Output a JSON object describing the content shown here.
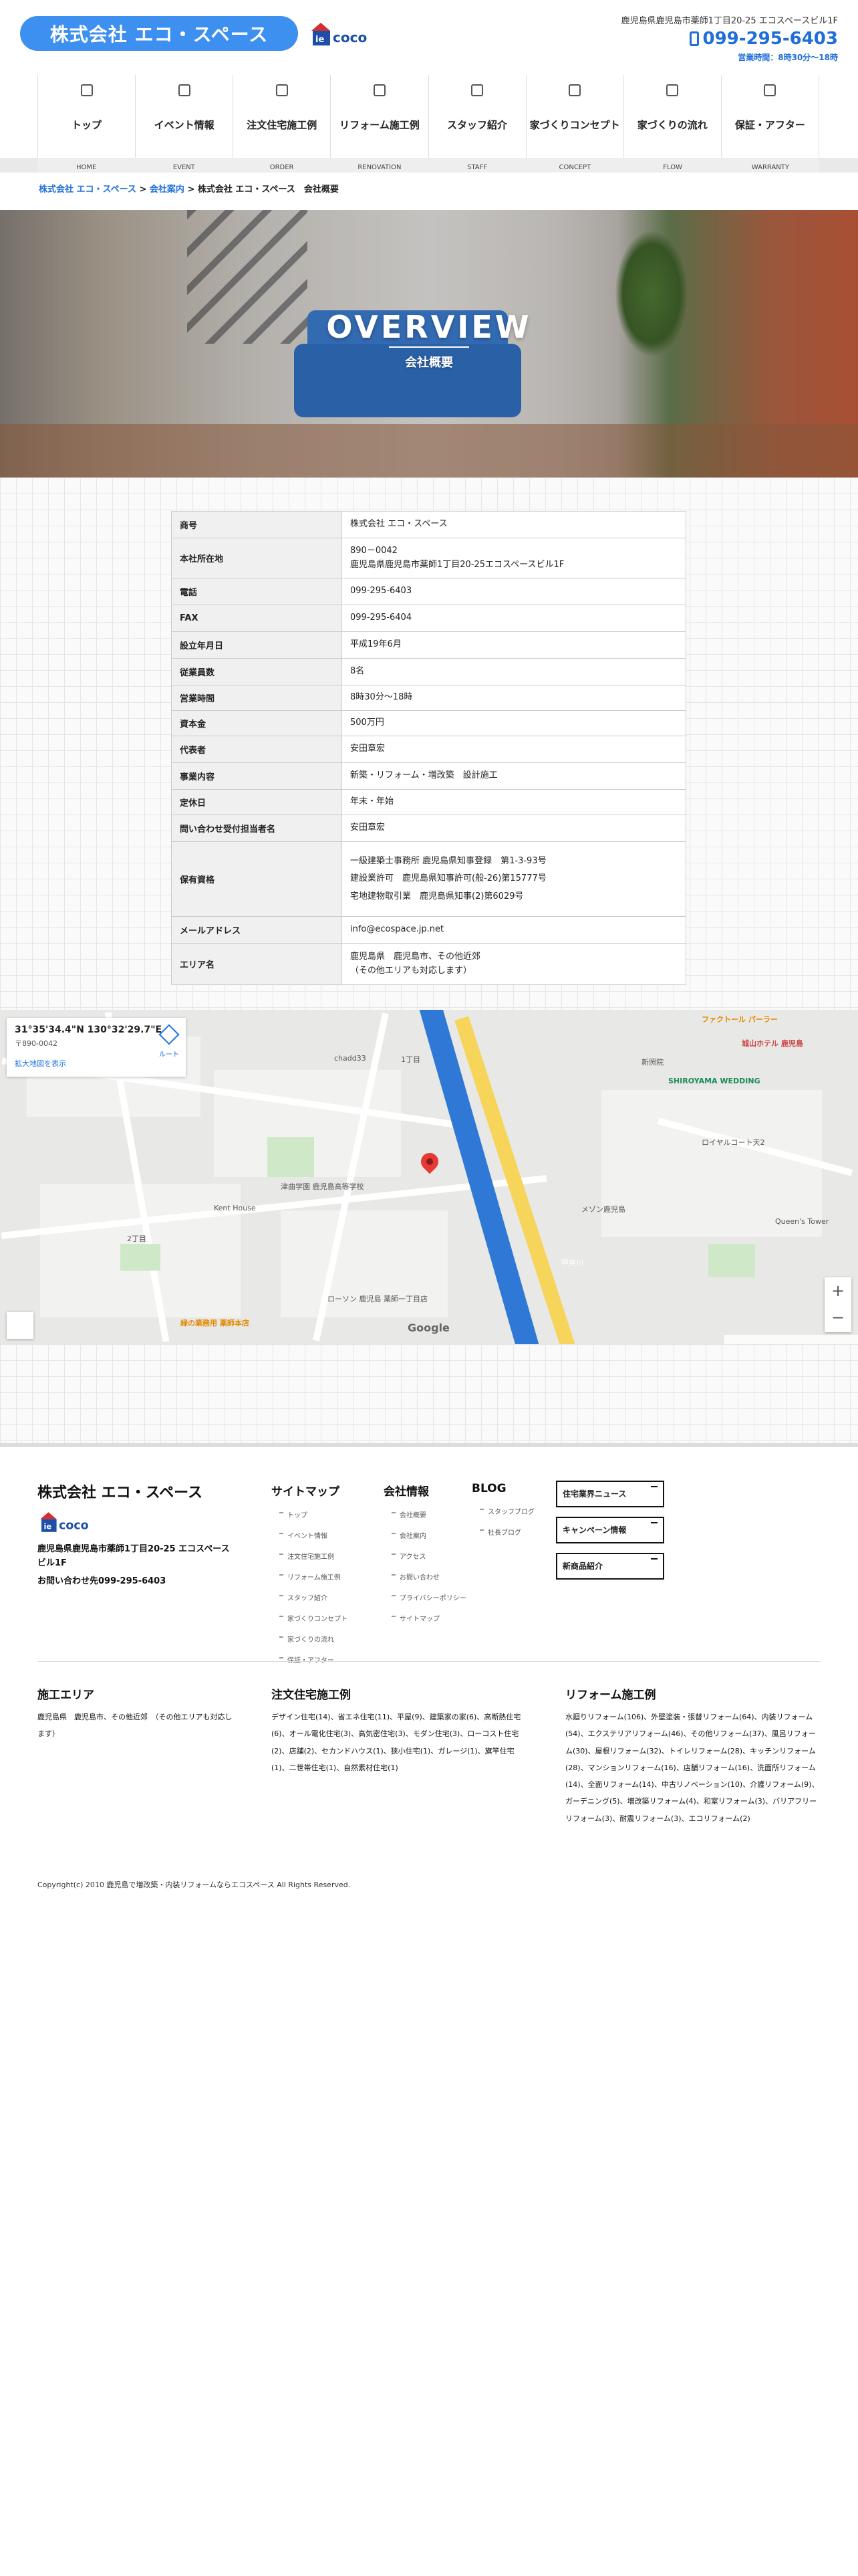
{
  "header": {
    "company_name": "株式会社 エコ・スペース",
    "iecoco_logo": "ie coco",
    "address": "鹿児島県鹿児島市薬師1丁目20-25 エコスペースビル1F",
    "tel": "099-295-6403",
    "hours": "営業時間：8時30分〜18時"
  },
  "nav": {
    "items": [
      {
        "label": "トップ",
        "en": "HOME"
      },
      {
        "label": "イベント情報",
        "en": "EVENT"
      },
      {
        "label": "注文住宅施工例",
        "en": "ORDER"
      },
      {
        "label": "リフォーム施工例",
        "en": "RENOVATION"
      },
      {
        "label": "スタッフ紹介",
        "en": "STAFF"
      },
      {
        "label": "家づくりコンセプト",
        "en": "CONCEPT"
      },
      {
        "label": "家づくりの流れ",
        "en": "FLOW"
      },
      {
        "label": "保証・アフター",
        "en": "WARRANTY"
      }
    ]
  },
  "breadcrumb": {
    "home": "株式会社 エコ・スペース",
    "sep": " > ",
    "parent": "会社案内",
    "current": "株式会社 エコ・スペース　会社概要"
  },
  "hero": {
    "title": "OVERVIEW",
    "subtitle": "会社概要"
  },
  "overview": {
    "company_label": "商号",
    "company_value": "株式会社 エコ・スペース",
    "address_label": "本社所在地",
    "address_zip": "890－0042",
    "address_value": "鹿児島県鹿児島市薬師1丁目20-25エコスペースビル1F",
    "tel_label": "電話",
    "tel_value": "099-295-6403",
    "fax_label": "FAX",
    "fax_value": "099-295-6404",
    "founded_label": "設立年月日",
    "founded_value": "平成19年6月",
    "employees_label": "従業員数",
    "employees_value": "8名",
    "hours_label": "営業時間",
    "hours_value": "8時30分〜18時",
    "capital_label": "資本金",
    "capital_value": "500万円",
    "rep_label": "代表者",
    "rep_value": "安田章宏",
    "business_label": "事業内容",
    "business_value": "新築・リフォーム・増改築　設計施工",
    "holiday_label": "定休日",
    "holiday_value": "年末・年始",
    "contact_label": "問い合わせ受付担当者名",
    "contact_value": "安田章宏",
    "license_label": "保有資格",
    "license_1": "一級建築士事務所 鹿児島県知事登録　第1-3-93号",
    "license_2": "建設業許可　鹿児島県知事許可(般-26)第15777号",
    "license_3": "宅地建物取引業　鹿児島県知事(2)第6029号",
    "email_label": "メールアドレス",
    "email_value": "info@ecospace.jp.net",
    "area_label": "エリア名",
    "area_value_1": "鹿児島県　鹿児島市、その他近郊",
    "area_value_2": "（その他エリアも対応します）"
  },
  "map": {
    "coord": "31°35'34.4\"N 130°32'29.7\"E",
    "card_sub": "〒890-0042",
    "card_link": "拡大地図を表示",
    "directions": "ルート",
    "labels": {
      "l1": "ファクトール パーラー",
      "l2": "城山ホテル 鹿児島",
      "l3": "SHIROYAMA WEDDING",
      "l4": "chadd33",
      "l5": "Kent House",
      "l6": "ローソン 鹿児島 薬師一丁目店",
      "l7": "津曲学園 鹿児島高等学校",
      "l8": "2丁目",
      "l9": "1丁目",
      "l10": "甲突川",
      "l11": "ロイヤルコート天2",
      "l12": "Queen's Tower",
      "l13": "新照院",
      "l14": "メゾン鹿児島",
      "l15": "緑の業務用 薬師本店"
    },
    "zoom_in": "+",
    "zoom_out": "−",
    "google": "Google"
  },
  "footer": {
    "company_name": "株式会社 エコ・スペース",
    "address": "鹿児島県鹿児島市薬師1丁目20-25 エコスペースビル1F",
    "tel_label": "お問い合わせ先",
    "tel": "099-295-6403",
    "sitemap_title": "サイトマップ",
    "sitemap_items": [
      "トップ",
      "イベント情報",
      "注文住宅施工例",
      "リフォーム施工例",
      "スタッフ紹介",
      "家づくりコンセプト",
      "家づくりの流れ",
      "保証・アフター"
    ],
    "company_title": "会社情報",
    "company_items": [
      "会社概要",
      "会社案内",
      "アクセス",
      "お問い合わせ",
      "プライバシーポリシー",
      "サイトマップ"
    ],
    "blog_title": "BLOG",
    "blog_items": [
      "スタッフブログ",
      "社長ブログ"
    ],
    "btn_news": "住宅業界ニュース",
    "btn_campaign": "キャンペーン情報",
    "btn_products": "新商品紹介",
    "area_title": "施工エリア",
    "area_body": "鹿児島県　鹿児島市、その他近郊　（その他エリアも対応します）",
    "order_title": "注文住宅施工例",
    "order_body": "デザイン住宅(14)、省エネ住宅(11)、平屋(9)、建築家の家(6)、高断熱住宅(6)、オール電化住宅(3)、高気密住宅(3)、モダン住宅(3)、ローコスト住宅(2)、店舗(2)、セカンドハウス(1)、狭小住宅(1)、ガレージ(1)、旗竿住宅(1)、二世帯住宅(1)、自然素材住宅(1)",
    "reform_title": "リフォーム施工例",
    "reform_body": "水廻りリフォーム(106)、外壁塗装・張替リフォーム(64)、内装リフォーム(54)、エクステリアリフォーム(46)、その他リフォーム(37)、風呂リフォーム(30)、屋根リフォーム(32)、トイレリフォーム(28)、キッチンリフォーム(28)、マンションリフォーム(16)、店舗リフォーム(16)、洗面所リフォーム(14)、全面リフォーム(14)、中古リノベーション(10)、介護リフォーム(9)、ガーデニング(5)、増改築リフォーム(4)、和室リフォーム(3)、バリアフリーリフォーム(3)、耐震リフォーム(3)、エコリフォーム(2)",
    "copyright": "Copyright(c) 2010 鹿児島で増改築・内装リフォームならエコスペース All Rights Reserved."
  },
  "colors": {
    "brand_blue": "#3d8ff0",
    "link_blue": "#1e6fd9"
  }
}
